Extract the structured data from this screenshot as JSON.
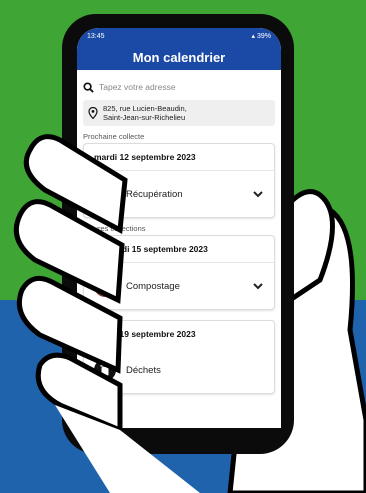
{
  "status": {
    "time": "13:45",
    "battery": "39%"
  },
  "app": {
    "title": "Mon calendrier"
  },
  "search": {
    "placeholder": "Tapez votre adresse"
  },
  "address": {
    "line1": "825, rue Lucien-Beaudin,",
    "line2": "Saint-Jean-sur-Richelieu"
  },
  "next_collection": {
    "label": "Prochaine collecte",
    "date": "mardi 12 septembre 2023",
    "type": "Récupération",
    "icon": "recycle-icon",
    "color": "#2f6fb7"
  },
  "future": {
    "label": "Futures collections",
    "items": [
      {
        "date": "vendredi 15 septembre 2023",
        "type": "Compostage",
        "icon": "compost-bin-icon",
        "color": "#7a3b2e"
      },
      {
        "date": "mardi 19 septembre 2023",
        "type": "Déchets",
        "icon": "trash-icon",
        "color": "#111111"
      }
    ]
  },
  "colors": {
    "green": "#3fa535",
    "blue": "#1f63ad",
    "appbar": "#1b4aa6"
  }
}
